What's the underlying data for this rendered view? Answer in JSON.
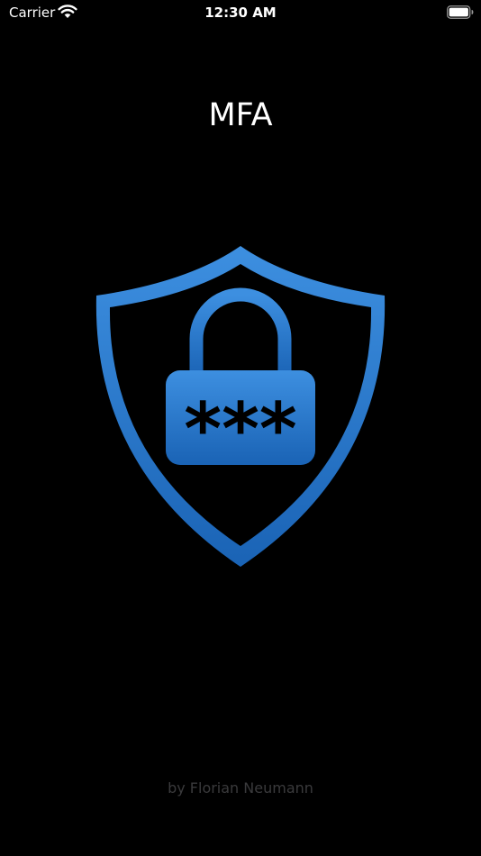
{
  "status_bar": {
    "carrier": "Carrier",
    "time": "12:30 AM",
    "icons": [
      "wifi-icon",
      "battery-icon"
    ]
  },
  "app": {
    "title": "MFA",
    "logo_icon": "shield-lock-icon",
    "logo_password_text": "***",
    "credit": "by Florian Neumann"
  },
  "colors": {
    "background": "#000000",
    "text": "#ffffff",
    "credit": "#3a3a3c",
    "accent_light": "#3d8fe0",
    "accent_dark": "#1a63b5"
  }
}
